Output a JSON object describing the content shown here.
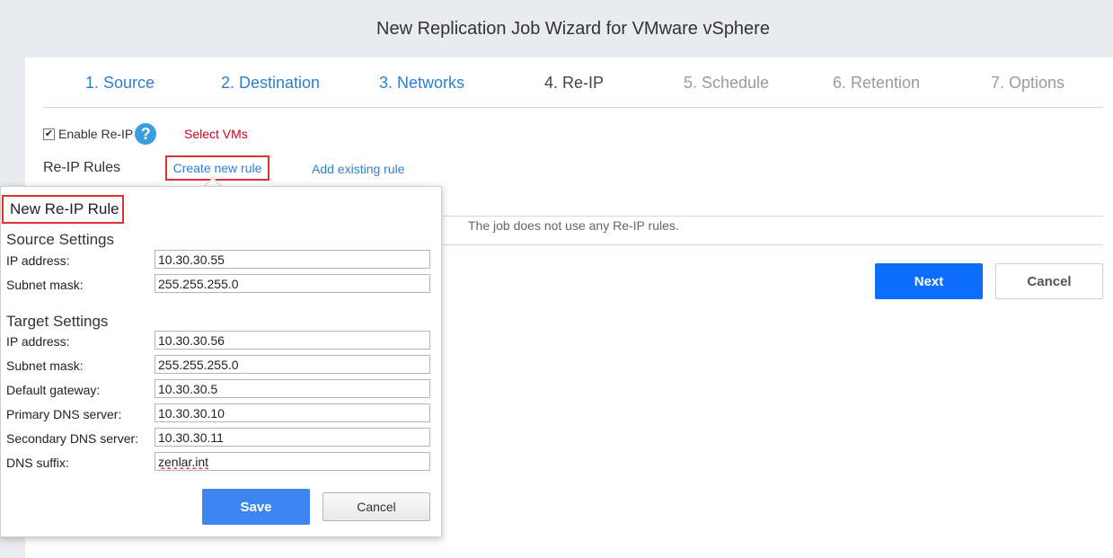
{
  "window": {
    "title": "New Replication Job Wizard for VMware vSphere"
  },
  "steps": [
    {
      "label": "1. Source",
      "state": "done"
    },
    {
      "label": "2. Destination",
      "state": "done"
    },
    {
      "label": "3. Networks",
      "state": "done"
    },
    {
      "label": "4. Re-IP",
      "state": "current"
    },
    {
      "label": "5. Schedule",
      "state": "future"
    },
    {
      "label": "6. Retention",
      "state": "future"
    },
    {
      "label": "7. Options",
      "state": "future"
    }
  ],
  "reip": {
    "enable_label": "Enable Re-IP",
    "enabled": true,
    "help_glyph": "?",
    "select_vms": "Select VMs",
    "rules_label": "Re-IP Rules",
    "create_rule": "Create new rule",
    "add_rule": "Add existing rule",
    "empty_message": "The job does not use any Re-IP rules."
  },
  "buttons": {
    "next": "Next",
    "cancel": "Cancel"
  },
  "popup": {
    "title": "New Re-IP Rule",
    "source": {
      "title": "Source Settings",
      "ip_label": "IP address:",
      "ip_value": "10.30.30.55",
      "mask_label": "Subnet mask:",
      "mask_value": "255.255.255.0"
    },
    "target": {
      "title": "Target Settings",
      "ip_label": "IP address:",
      "ip_value": "10.30.30.56",
      "mask_label": "Subnet mask:",
      "mask_value": "255.255.255.0",
      "gateway_label": "Default gateway:",
      "gateway_value": "10.30.30.5",
      "dns1_label": "Primary DNS server:",
      "dns1_value": "10.30.30.10",
      "dns2_label": "Secondary DNS server:",
      "dns2_value": "10.30.30.11",
      "suffix_label": "DNS suffix:",
      "suffix_value": "zenlar.int"
    },
    "save": "Save",
    "cancel": "Cancel"
  },
  "colors": {
    "link": "#2f7fd1",
    "primary_button": "#0d6efd",
    "highlight_border": "#e0312f",
    "warning_text": "#d0021b"
  }
}
